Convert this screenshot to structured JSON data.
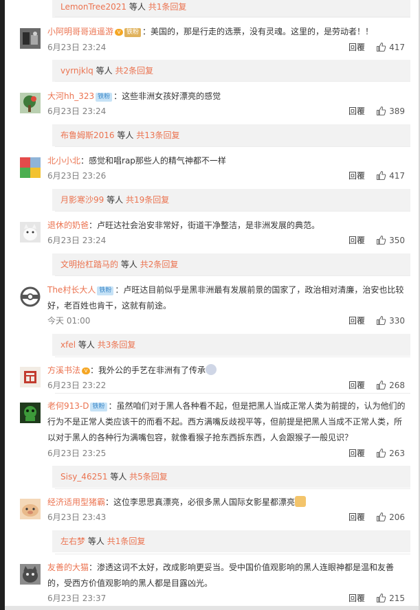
{
  "ui": {
    "reply_label": "回覆",
    "sub_mid_text": "等人",
    "colors": {
      "link": "#eb7350",
      "subbox": "#f2f2f2",
      "meta": "#808080"
    }
  },
  "top_sub": {
    "name": "LemonTree2021",
    "mid": "等人",
    "count": "共1条回复"
  },
  "comments": [
    {
      "user": "小阿明哥哥逍遥游",
      "badge": "铁粉",
      "text": "：美国的，那是行走的选票，没有灵魂。这里的，是劳动者！！",
      "time": "6月23日 23:24",
      "likes": "417",
      "sub": {
        "name": "vyrnjklq",
        "count": "共2条回复"
      }
    },
    {
      "user": "大河hh_323",
      "badge": "铁粉",
      "text": "：这些非洲女孩好漂亮的感觉",
      "time": "6月23日 23:24",
      "likes": "389",
      "sub": {
        "name": "布鲁姆斯2016",
        "count": "共13条回复"
      }
    },
    {
      "user": "北小小北",
      "badge": "",
      "text": "：感觉和唱rap那些人的精气神都不一样",
      "time": "6月23日 23:26",
      "likes": "417",
      "sub": {
        "name": "月影寒沙99",
        "count": "共19条回复"
      }
    },
    {
      "user": "退休的奶爸",
      "badge": "",
      "text": "：卢旺达社会治安非常好，街道干净整洁，是非洲发展的典范。",
      "time": "6月23日 23:24",
      "likes": "350",
      "sub": {
        "name": "文明抬杠踏马的",
        "count": "共2条回复"
      }
    },
    {
      "user": "The村长大人",
      "badge": "铁粉",
      "text_lines": [
        "：卢旺达目前似乎是黑非洲最有发展前景的国家了，政治相对清廉，治安也比较",
        "好，老百姓也肯干，这就有前途。"
      ],
      "time": "今天 01:00",
      "likes": "330",
      "sub": {
        "name": "xfel",
        "count": "共3条回复"
      }
    },
    {
      "user": "方溪书法",
      "badge": "",
      "text": "：我外公的手艺在非洲有了传承",
      "time": "6月23日 23:22",
      "likes": "268"
    },
    {
      "user": "老何913-D",
      "badge": "铁粉",
      "text_lines": [
        "：虽然咱们对于黑人各种看不起，但是把黑人当成正常人类为前提的，认为他们的",
        "行为不是正常人类应该干的而看不起。西方满嘴反歧视平等，但前提是把黑人当成不正常人类，所",
        "以对于黑人的各种行为满嘴包容，就像看猴子抢东西拆东西，人会跟猴子一般见识？"
      ],
      "time": "6月23日 23:25",
      "likes": "263",
      "sub": {
        "name": "Sisy_46251",
        "count": "共5条回复"
      }
    },
    {
      "user": "经济适用型猪霸",
      "badge": "",
      "text": "：这位李思思真漂亮，必很多黑人国际女影星都漂亮",
      "time": "6月23日 23:43",
      "likes": "206",
      "sub": {
        "name": "左右梦",
        "count": "共1条回复"
      }
    },
    {
      "user": "友善的大猫",
      "badge": "",
      "text_lines": [
        "：渗透这词不太好，改成影响更妥当。受中国价值观影响的黑人连眼神都是温和友善",
        "的，受西方价值观影响的黑人都是目露凶光。"
      ],
      "time": "6月23日 23:37",
      "likes": "215"
    }
  ]
}
